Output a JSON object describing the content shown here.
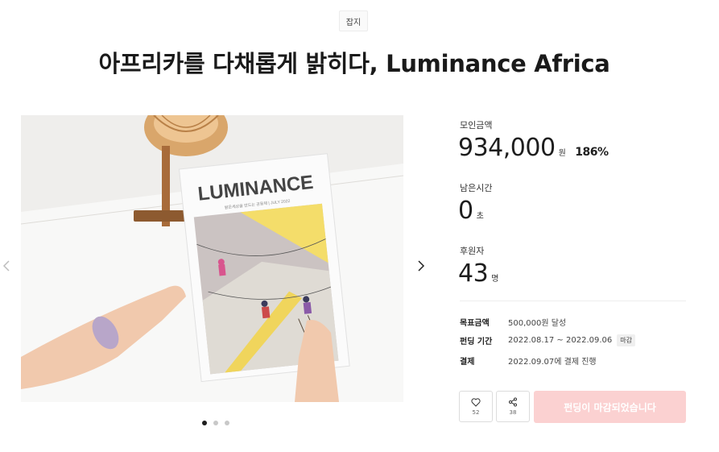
{
  "category": {
    "label": "잡지"
  },
  "title": "아프리카를 다채롭게 밝히다, Luminance Africa",
  "gallery": {
    "magazine_title": "LUMINANCE",
    "magazine_subtitle": "밝은세상을 만드는 공동체 | JULY 2022",
    "slide_count": 3,
    "active_slide": 1
  },
  "stats": {
    "raised": {
      "label": "모인금액",
      "value": "934,000",
      "unit": "원",
      "percent": "186%"
    },
    "remaining": {
      "label": "남은시간",
      "value": "0",
      "unit": "초"
    },
    "backers": {
      "label": "후원자",
      "value": "43",
      "unit": "명"
    }
  },
  "details": {
    "goal": {
      "key": "목표금액",
      "value": "500,000원 달성"
    },
    "period": {
      "key": "펀딩 기간",
      "value": "2022.08.17 ~ 2022.09.06",
      "status": "마감"
    },
    "payment": {
      "key": "결제",
      "value": "2022.09.07에 결제 진행"
    }
  },
  "actions": {
    "like_count": "52",
    "share_count": "38",
    "closed_label": "펀딩이 마감되었습니다"
  },
  "colors": {
    "closed_button": "#fbd1d1",
    "active_dot": "#1e1e1e"
  }
}
